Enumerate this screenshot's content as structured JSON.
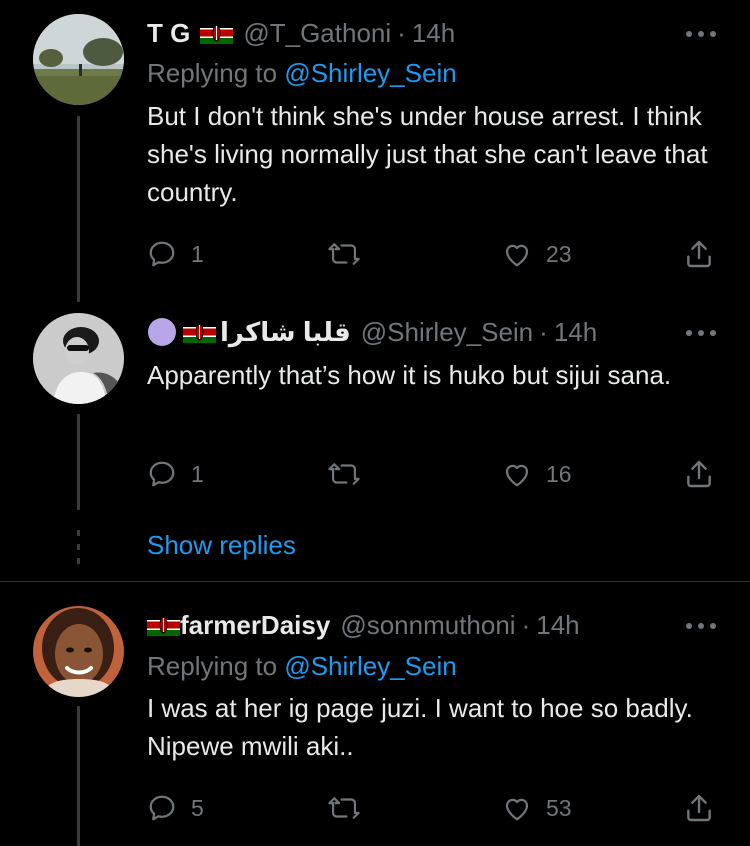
{
  "tweets": [
    {
      "name": "T G",
      "handle": "@T_Gathoni",
      "time": "14h",
      "replying_label": "Replying to",
      "replying_handle": "@Shirley_Sein",
      "text": "But I don't think she's under house arrest. I think she's living normally just that she can't leave that country.",
      "replies": "1",
      "retweets": "",
      "likes": "23"
    },
    {
      "name": "قلبا شاكرا",
      "handle": "@Shirley_Sein",
      "time": "14h",
      "text": "Apparently that’s how it is huko but sijui sana.",
      "replies": "1",
      "retweets": "",
      "likes": "16"
    },
    {
      "name": "farmerDaisy",
      "handle": "@sonnmuthoni",
      "time": "14h",
      "replying_label": "Replying to",
      "replying_handle": "@Shirley_Sein",
      "text": "I was at her ig page juzi. I want to hoe so badly. Nipewe mwili aki..",
      "replies": "5",
      "retweets": "",
      "likes": "53"
    }
  ],
  "show_replies": "Show replies",
  "separator_dot": "·",
  "colors": {
    "background": "#000000",
    "text": "#e7e9ea",
    "muted": "#71767b",
    "link": "#1d9bf0",
    "thread_line": "#3a3d40",
    "purple_circle": "#b9a6e8"
  }
}
